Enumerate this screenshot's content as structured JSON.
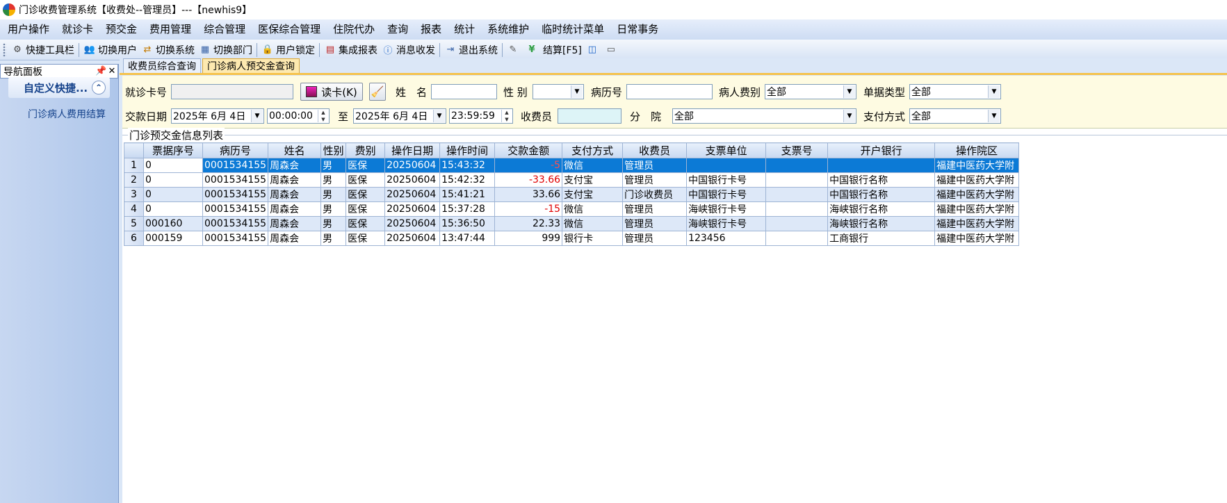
{
  "window": {
    "title": "门诊收费管理系统【收费处--管理员】---【newhis9】"
  },
  "menu": [
    "用户操作",
    "就诊卡",
    "预交金",
    "费用管理",
    "综合管理",
    "医保综合管理",
    "住院代办",
    "查询",
    "报表",
    "统计",
    "系统维护",
    "临时统计菜单",
    "日常事务"
  ],
  "toolbar": {
    "items": [
      {
        "label": "快捷工具栏",
        "icon": "quick-toolbar-icon"
      },
      {
        "label": "切换用户",
        "icon": "switch-user-icon"
      },
      {
        "label": "切换系统",
        "icon": "switch-system-icon"
      },
      {
        "label": "切换部门",
        "icon": "switch-department-icon"
      },
      {
        "label": "用户锁定",
        "icon": "user-lock-icon"
      },
      {
        "label": "集成报表",
        "icon": "integrated-report-icon"
      },
      {
        "label": "消息收发",
        "icon": "message-icon"
      },
      {
        "label": "退出系统",
        "icon": "exit-icon"
      },
      {
        "label": "",
        "icon": "edit-icon"
      },
      {
        "label": "结算[F5]",
        "icon": "settle-yen-icon"
      },
      {
        "label": "",
        "icon": "layout-icon"
      },
      {
        "label": "",
        "icon": "window-icon"
      }
    ]
  },
  "nav": {
    "title": "导航面板",
    "group": "自定义快捷...",
    "link": "门诊病人费用结算"
  },
  "tabs": [
    "收费员综合查询",
    "门诊病人预交金查询"
  ],
  "active_tab": 1,
  "filter": {
    "card_label": "就诊卡号",
    "read_card_button": "读卡(K)",
    "name_label": "姓　名",
    "gender_label": "性 别",
    "record_no_label": "病历号",
    "patient_fee_label": "病人费别",
    "patient_fee_value": "全部",
    "doc_type_label": "单据类型",
    "doc_type_value": "全部",
    "pay_date_label": "交款日期",
    "date_from": "2025年 6月 4日",
    "time_from": "00:00:00",
    "to_label": "至",
    "date_to": "2025年 6月 4日",
    "time_to": "23:59:59",
    "cashier_label": "收费员",
    "branch_label": "分　院",
    "branch_value": "全部",
    "pay_method_label": "支付方式",
    "pay_method_value": "全部"
  },
  "list_caption": "门诊预交金信息列表",
  "table": {
    "columns": [
      "票据序号",
      "病历号",
      "姓名",
      "性别",
      "费别",
      "操作日期",
      "操作时间",
      "交款金额",
      "支付方式",
      "收费员",
      "支票单位",
      "支票号",
      "开户银行",
      "操作院区"
    ],
    "rows": [
      [
        "1",
        "0",
        "0001534155",
        "周森会",
        "男",
        "医保",
        "20250604",
        "15:43:32",
        "-5",
        "微信",
        "管理员",
        "",
        "",
        "",
        "福建中医药大学附"
      ],
      [
        "2",
        "0",
        "0001534155",
        "周森会",
        "男",
        "医保",
        "20250604",
        "15:42:32",
        "-33.66",
        "支付宝",
        "管理员",
        "中国银行卡号",
        "",
        "中国银行名称",
        "福建中医药大学附"
      ],
      [
        "3",
        "0",
        "0001534155",
        "周森会",
        "男",
        "医保",
        "20250604",
        "15:41:21",
        "33.66",
        "支付宝",
        "门诊收费员",
        "中国银行卡号",
        "",
        "中国银行名称",
        "福建中医药大学附"
      ],
      [
        "4",
        "0",
        "0001534155",
        "周森会",
        "男",
        "医保",
        "20250604",
        "15:37:28",
        "-15",
        "微信",
        "管理员",
        "海峡银行卡号",
        "",
        "海峡银行名称",
        "福建中医药大学附"
      ],
      [
        "5",
        "000160",
        "0001534155",
        "周森会",
        "男",
        "医保",
        "20250604",
        "15:36:50",
        "22.33",
        "微信",
        "管理员",
        "海峡银行卡号",
        "",
        "海峡银行名称",
        "福建中医药大学附"
      ],
      [
        "6",
        "000159",
        "0001534155",
        "周森会",
        "男",
        "医保",
        "20250604",
        "13:47:44",
        "999",
        "银行卡",
        "管理员",
        "123456",
        "",
        "工商银行",
        "福建中医药大学附"
      ]
    ]
  },
  "colors": {
    "selected_row": "#0c7ad6",
    "negative": "#e00000",
    "tab_active": "#fde9b0"
  }
}
